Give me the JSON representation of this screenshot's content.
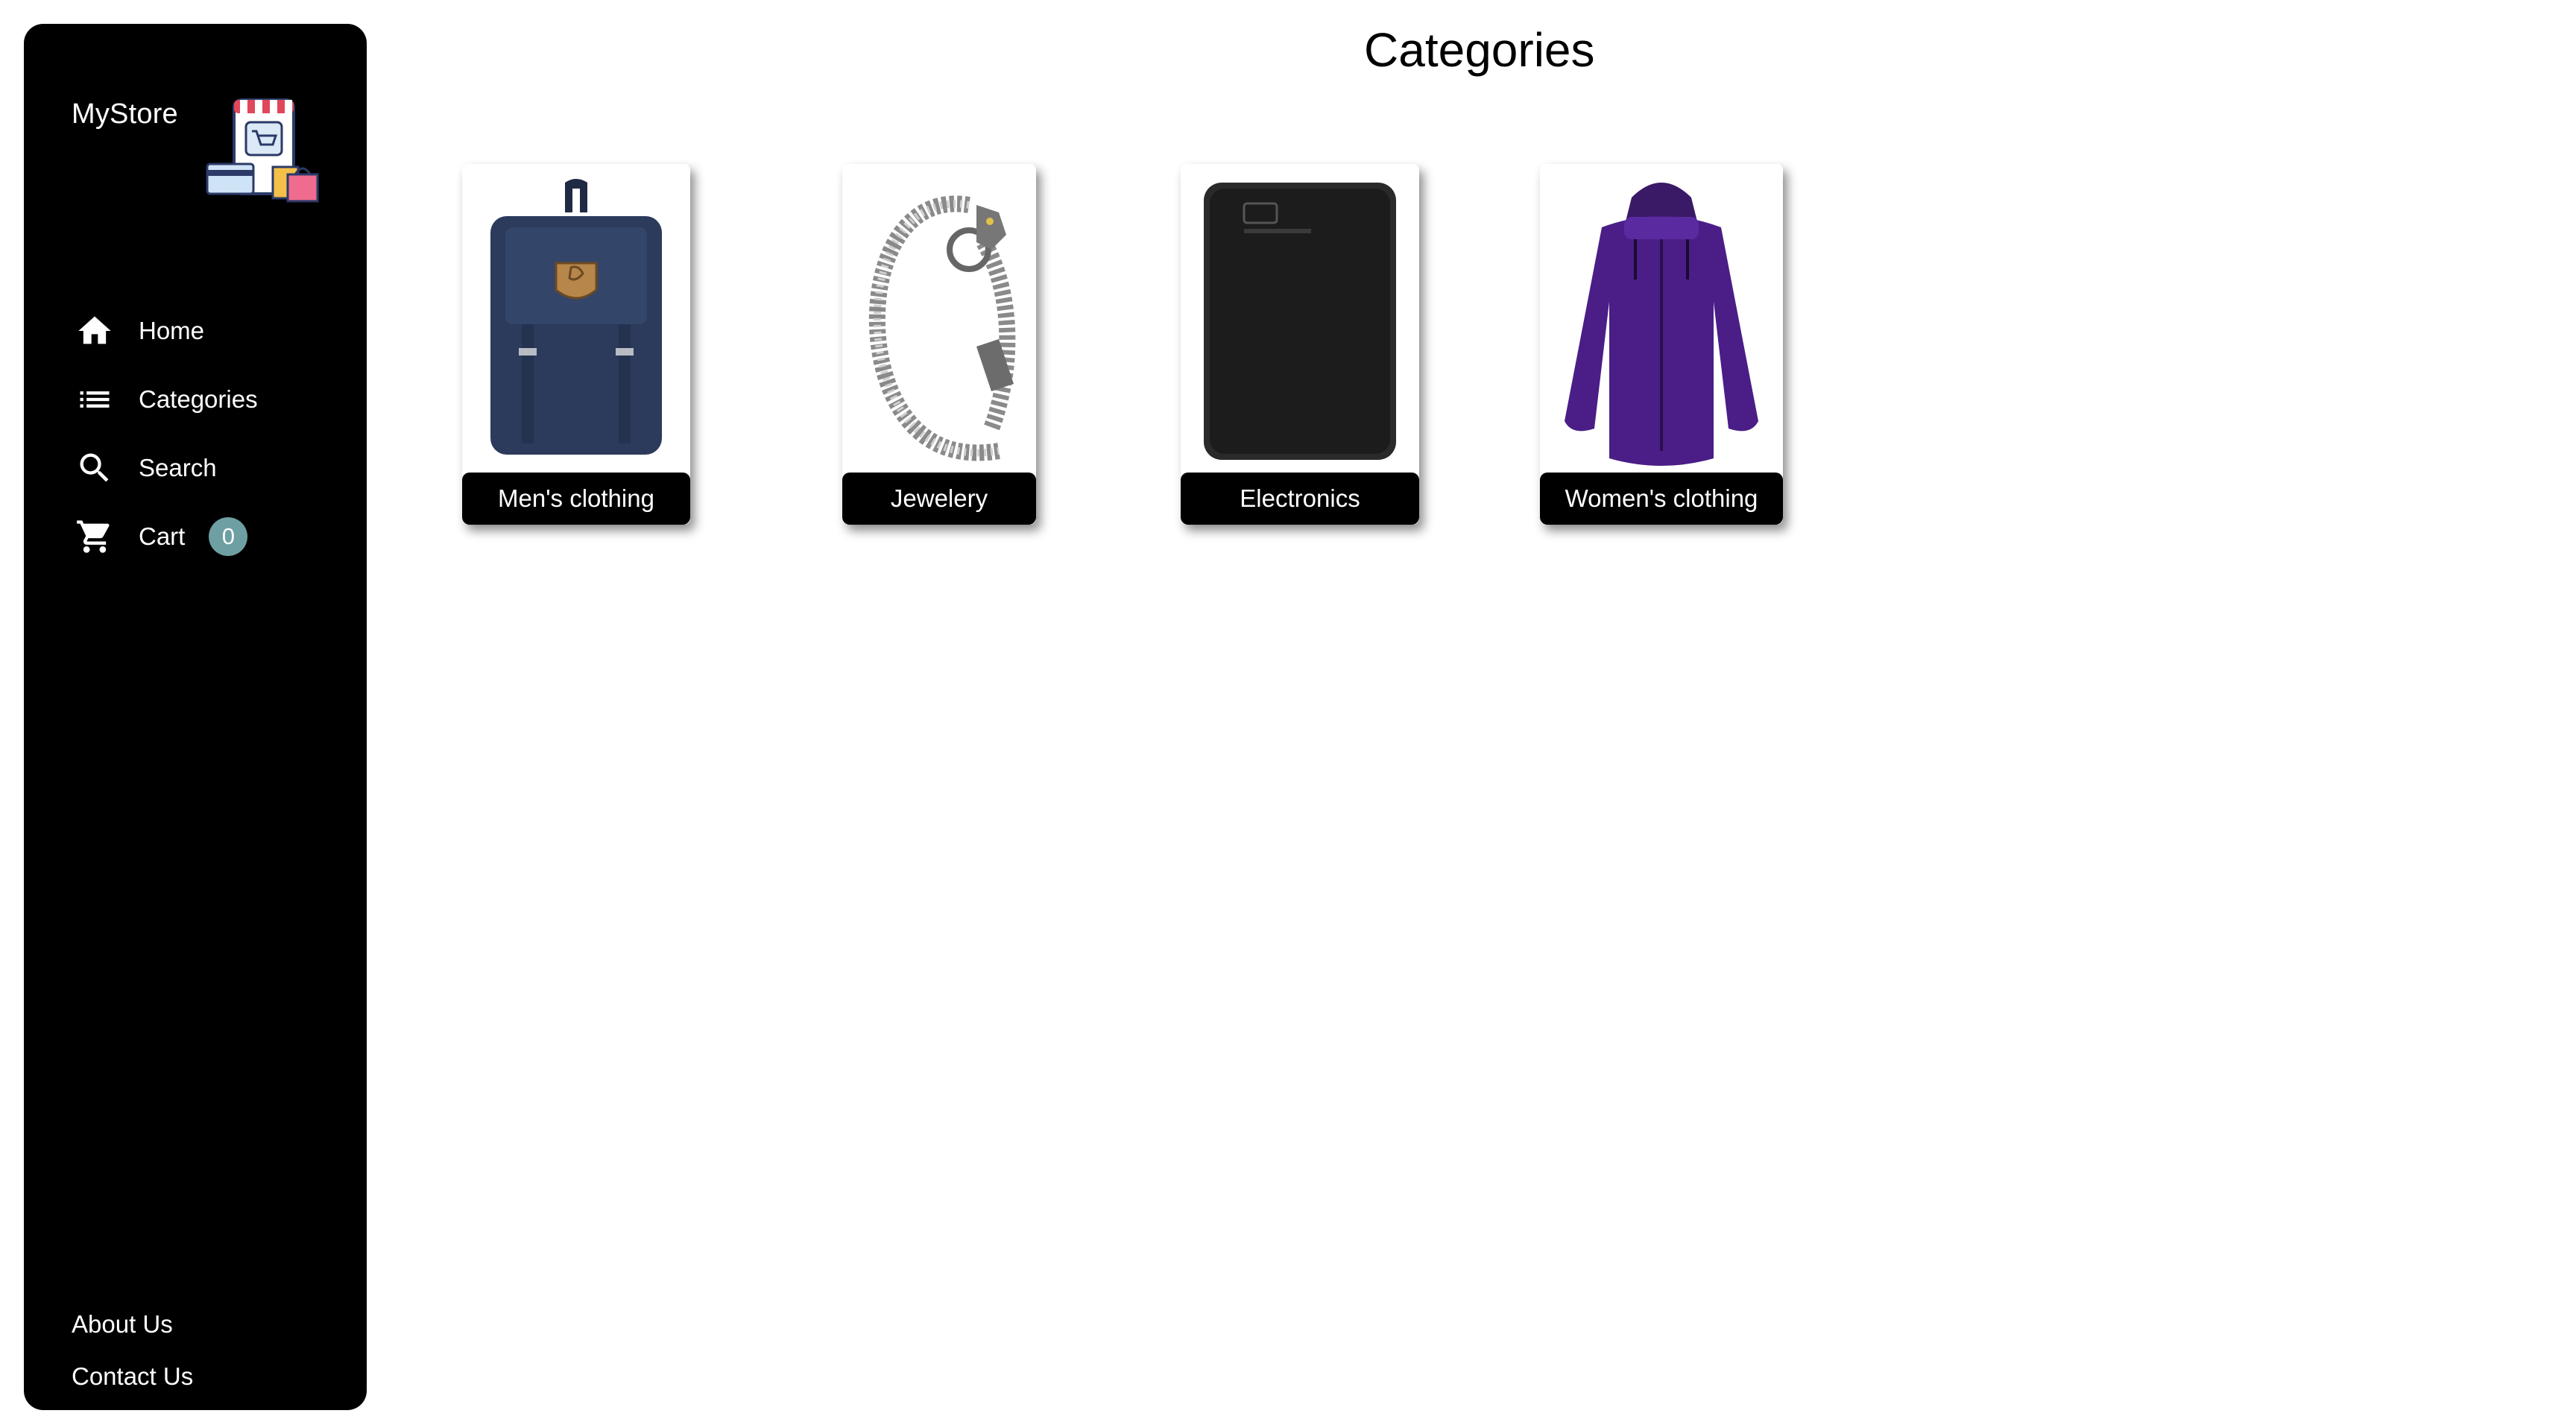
{
  "sidebar": {
    "brand": "MyStore",
    "nav": [
      {
        "label": "Home",
        "icon": "home-icon"
      },
      {
        "label": "Categories",
        "icon": "list-icon"
      },
      {
        "label": "Search",
        "icon": "search-icon"
      },
      {
        "label": "Cart",
        "icon": "cart-icon",
        "badge": "0"
      }
    ],
    "footer": [
      {
        "label": "About Us"
      },
      {
        "label": "Contact Us"
      }
    ]
  },
  "main": {
    "title": "Categories",
    "categories": [
      {
        "label": "Men's clothing",
        "image": "backpack"
      },
      {
        "label": "Jewelery",
        "image": "bracelet"
      },
      {
        "label": "Electronics",
        "image": "hard-drive"
      },
      {
        "label": "Women's clothing",
        "image": "jacket"
      }
    ]
  },
  "colors": {
    "sidebar_bg": "#000000",
    "badge_bg": "#6e9fa2",
    "label_bg": "#000000",
    "page_bg": "#ffffff"
  }
}
